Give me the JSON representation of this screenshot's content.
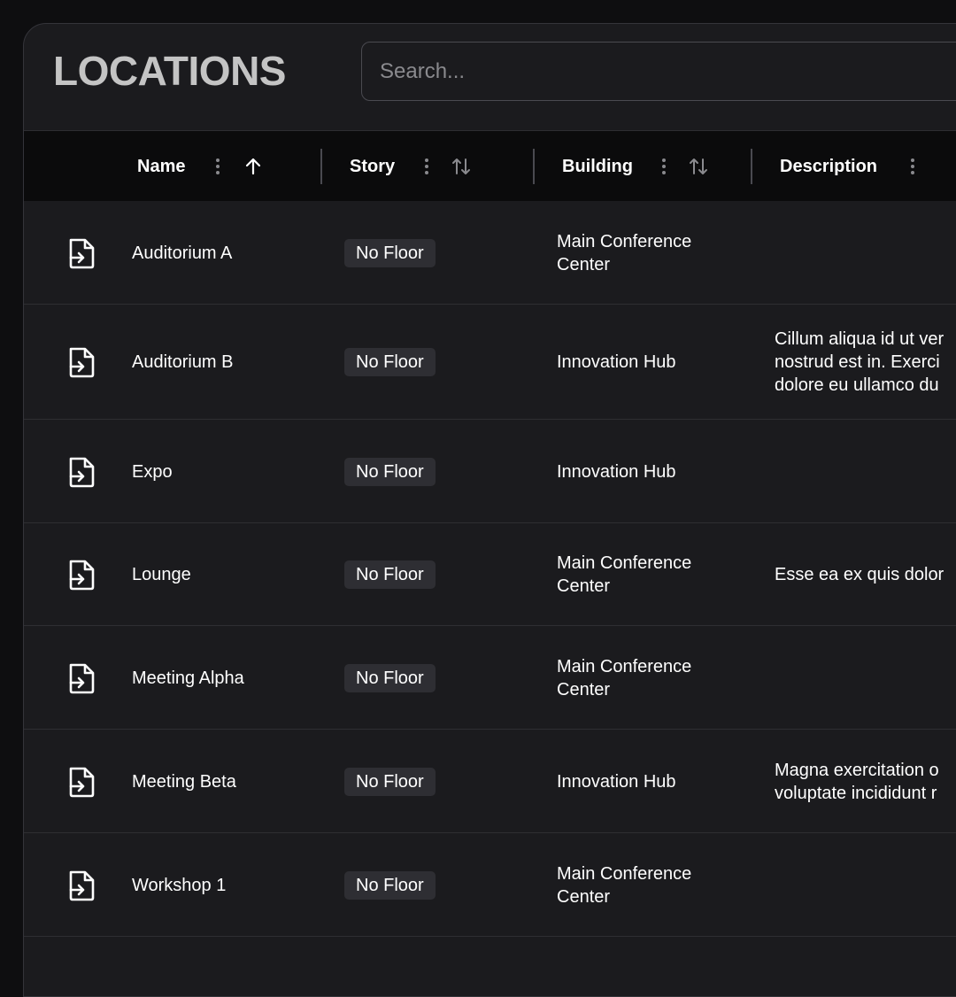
{
  "header": {
    "title": "LOCATIONS",
    "search_placeholder": "Search..."
  },
  "columns": [
    {
      "label": "Name",
      "sort": "ascending"
    },
    {
      "label": "Story",
      "sort": "none"
    },
    {
      "label": "Building",
      "sort": "none"
    },
    {
      "label": "Description",
      "sort": "none"
    }
  ],
  "icons": {
    "row_icon": "file-enter-icon",
    "menu_icon": "kebab-menu-icon",
    "sort_asc_icon": "arrow-up-icon",
    "sort_both_icon": "sort-arrows-icon"
  },
  "rows": [
    {
      "name": "Auditorium A",
      "story": "No Floor",
      "building": "Main Conference\nCenter",
      "description": ""
    },
    {
      "name": "Auditorium B",
      "story": "No Floor",
      "building": "Innovation Hub",
      "description": "Cillum aliqua id ut ver\nnostrud est in. Exerci\ndolore eu ullamco du"
    },
    {
      "name": "Expo",
      "story": "No Floor",
      "building": "Innovation Hub",
      "description": ""
    },
    {
      "name": "Lounge",
      "story": "No Floor",
      "building": "Main Conference\nCenter",
      "description": "Esse ea ex quis dolor"
    },
    {
      "name": "Meeting Alpha",
      "story": "No Floor",
      "building": "Main Conference\nCenter",
      "description": ""
    },
    {
      "name": "Meeting Beta",
      "story": "No Floor",
      "building": "Innovation Hub",
      "description": "Magna exercitation o\nvoluptate incididunt r"
    },
    {
      "name": "Workshop 1",
      "story": "No Floor",
      "building": "Main Conference\nCenter",
      "description": ""
    }
  ]
}
